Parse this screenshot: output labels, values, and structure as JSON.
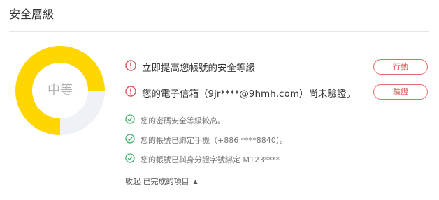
{
  "header": {
    "title": "安全層級"
  },
  "security_level": {
    "label": "中等",
    "level_fraction": 0.75,
    "fill_color": "#FFD600",
    "track_color": "#EEF2F6"
  },
  "warnings": [
    {
      "icon": "exclamation-circle-icon",
      "text": "立即提高您帳號的安全等級",
      "button_label": "行動"
    },
    {
      "icon": "exclamation-circle-icon",
      "text": "您的電子信箱（9jr****@9hmh.com）尚未驗證。",
      "button_label": "驗證"
    }
  ],
  "completed": [
    {
      "icon": "check-circle-icon",
      "text": "您的密碼安全等級較高。"
    },
    {
      "icon": "check-circle-icon",
      "text": "您的帳號已綁定手機（+886 ****8840）。"
    },
    {
      "icon": "check-circle-icon",
      "text": "您的帳號已與身分證字號綁定 M123****"
    }
  ],
  "collapse": {
    "label": "收起 已完成的項目",
    "arrow": "▲"
  },
  "colors": {
    "warning": "#D9534F",
    "success": "#3DB36B"
  }
}
